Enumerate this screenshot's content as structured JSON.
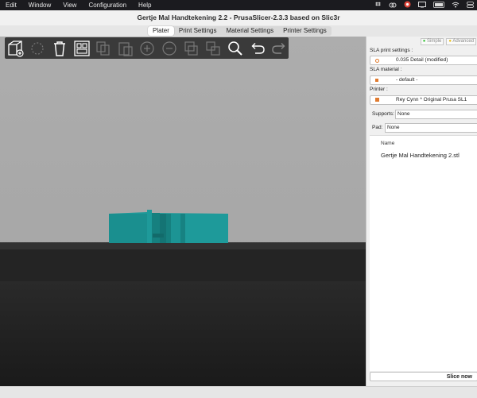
{
  "menubar": {
    "items": [
      "Edit",
      "Window",
      "View",
      "Configuration",
      "Help"
    ],
    "battery_label": "US"
  },
  "window": {
    "title": "Gertje Mal Handtekening 2.2 - PrusaSlicer-2.3.3 based on Slic3r"
  },
  "tabs": [
    {
      "label": "Plater",
      "active": true
    },
    {
      "label": "Print Settings",
      "active": false
    },
    {
      "label": "Material Settings",
      "active": false
    },
    {
      "label": "Printer Settings",
      "active": false
    }
  ],
  "toolbar": {
    "icons": [
      "add-icon",
      "delete-icon",
      "delete-all-icon",
      "arrange-icon",
      "copy-icon",
      "paste-icon",
      "instance-add-icon",
      "instance-remove-icon",
      "split-objects-icon",
      "split-parts-icon",
      "search-icon",
      "undo-icon",
      "redo-icon"
    ]
  },
  "sidebar": {
    "mode_simple": "Simple",
    "mode_advanced": "Advanced",
    "print_settings_label": "SLA print settings :",
    "print_settings_value": "0.035 Detail (modified)",
    "material_label": "SLA material :",
    "material_value": "- default -",
    "printer_label": "Printer :",
    "printer_value": "Rey Cynn * Original Prusa SL1",
    "supports_label": "Supports:",
    "supports_value": "None",
    "pad_label": "Pad:",
    "pad_value": "None",
    "object_list_header": "Name",
    "object_name": "Gertje Mal Handtekening 2.stl",
    "slice_button": "Slice now"
  },
  "colors": {
    "model": "#1e9a9a",
    "accent_orange": "#e07a2e",
    "mode_green": "#3cc23c",
    "mode_yellow": "#e8c020"
  }
}
